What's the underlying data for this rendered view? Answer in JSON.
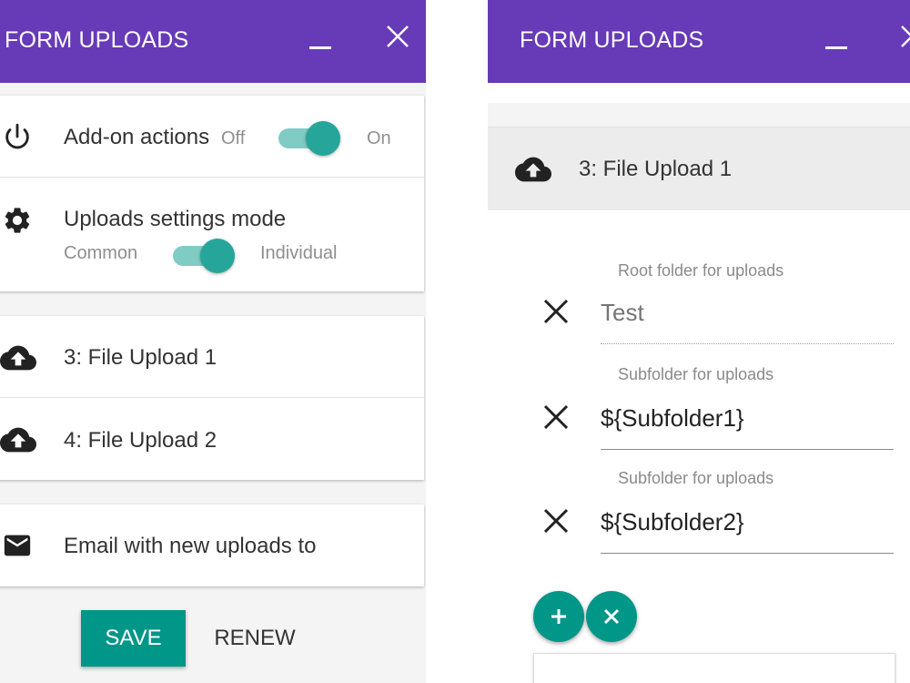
{
  "left_panel": {
    "header": {
      "title": "FORM UPLOADS"
    },
    "addon_actions": {
      "label": "Add-on actions",
      "off_label": "Off",
      "on_label": "On",
      "enabled": true
    },
    "settings_mode": {
      "label": "Uploads settings mode",
      "left_label": "Common",
      "right_label": "Individual",
      "selected": "Individual"
    },
    "uploads": [
      {
        "label": "3: File Upload 1"
      },
      {
        "label": "4: File Upload 2"
      }
    ],
    "email": {
      "label": "Email with new uploads to"
    },
    "buttons": {
      "save": "SAVE",
      "renew": "RENEW"
    }
  },
  "right_panel": {
    "header": {
      "title": "FORM UPLOADS"
    },
    "upload": {
      "label": "3: File Upload 1"
    },
    "fields": [
      {
        "label": "Root folder for uploads",
        "value": "",
        "placeholder": "Test"
      },
      {
        "label": "Subfolder for uploads",
        "value": "${Subfolder1}",
        "placeholder": ""
      },
      {
        "label": "Subfolder for uploads",
        "value": "${Subfolder2}",
        "placeholder": ""
      }
    ]
  },
  "colors": {
    "header": "#673ab7",
    "accent": "#009688",
    "toggle_track": "#80cbc4",
    "toggle_thumb": "#26a69a"
  },
  "icons": [
    "power-icon",
    "gear-icon",
    "cloud-upload-icon",
    "mail-icon",
    "close-icon",
    "minimize-icon",
    "clear-icon",
    "plus-icon"
  ]
}
